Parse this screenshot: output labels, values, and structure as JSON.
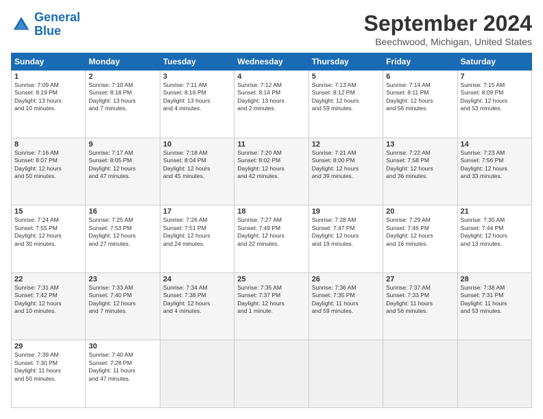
{
  "header": {
    "logo_general": "General",
    "logo_blue": "Blue",
    "month_title": "September 2024",
    "location": "Beechwood, Michigan, United States"
  },
  "days_of_week": [
    "Sunday",
    "Monday",
    "Tuesday",
    "Wednesday",
    "Thursday",
    "Friday",
    "Saturday"
  ],
  "weeks": [
    [
      {
        "day": "1",
        "info": "Sunrise: 7:09 AM\nSunset: 8:19 PM\nDaylight: 13 hours\nand 10 minutes."
      },
      {
        "day": "2",
        "info": "Sunrise: 7:10 AM\nSunset: 8:18 PM\nDaylight: 13 hours\nand 7 minutes."
      },
      {
        "day": "3",
        "info": "Sunrise: 7:11 AM\nSunset: 8:16 PM\nDaylight: 13 hours\nand 4 minutes."
      },
      {
        "day": "4",
        "info": "Sunrise: 7:12 AM\nSunset: 8:14 PM\nDaylight: 13 hours\nand 2 minutes."
      },
      {
        "day": "5",
        "info": "Sunrise: 7:13 AM\nSunset: 8:12 PM\nDaylight: 12 hours\nand 59 minutes."
      },
      {
        "day": "6",
        "info": "Sunrise: 7:14 AM\nSunset: 8:11 PM\nDaylight: 12 hours\nand 56 minutes."
      },
      {
        "day": "7",
        "info": "Sunrise: 7:15 AM\nSunset: 8:09 PM\nDaylight: 12 hours\nand 53 minutes."
      }
    ],
    [
      {
        "day": "8",
        "info": "Sunrise: 7:16 AM\nSunset: 8:07 PM\nDaylight: 12 hours\nand 50 minutes."
      },
      {
        "day": "9",
        "info": "Sunrise: 7:17 AM\nSunset: 8:05 PM\nDaylight: 12 hours\nand 47 minutes."
      },
      {
        "day": "10",
        "info": "Sunrise: 7:18 AM\nSunset: 8:04 PM\nDaylight: 12 hours\nand 45 minutes."
      },
      {
        "day": "11",
        "info": "Sunrise: 7:20 AM\nSunset: 8:02 PM\nDaylight: 12 hours\nand 42 minutes."
      },
      {
        "day": "12",
        "info": "Sunrise: 7:21 AM\nSunset: 8:00 PM\nDaylight: 12 hours\nand 39 minutes."
      },
      {
        "day": "13",
        "info": "Sunrise: 7:22 AM\nSunset: 7:58 PM\nDaylight: 12 hours\nand 36 minutes."
      },
      {
        "day": "14",
        "info": "Sunrise: 7:23 AM\nSunset: 7:56 PM\nDaylight: 12 hours\nand 33 minutes."
      }
    ],
    [
      {
        "day": "15",
        "info": "Sunrise: 7:24 AM\nSunset: 7:55 PM\nDaylight: 12 hours\nand 30 minutes."
      },
      {
        "day": "16",
        "info": "Sunrise: 7:25 AM\nSunset: 7:53 PM\nDaylight: 12 hours\nand 27 minutes."
      },
      {
        "day": "17",
        "info": "Sunrise: 7:26 AM\nSunset: 7:51 PM\nDaylight: 12 hours\nand 24 minutes."
      },
      {
        "day": "18",
        "info": "Sunrise: 7:27 AM\nSunset: 7:49 PM\nDaylight: 12 hours\nand 22 minutes."
      },
      {
        "day": "19",
        "info": "Sunrise: 7:28 AM\nSunset: 7:47 PM\nDaylight: 12 hours\nand 19 minutes."
      },
      {
        "day": "20",
        "info": "Sunrise: 7:29 AM\nSunset: 7:46 PM\nDaylight: 12 hours\nand 16 minutes."
      },
      {
        "day": "21",
        "info": "Sunrise: 7:30 AM\nSunset: 7:44 PM\nDaylight: 12 hours\nand 13 minutes."
      }
    ],
    [
      {
        "day": "22",
        "info": "Sunrise: 7:31 AM\nSunset: 7:42 PM\nDaylight: 12 hours\nand 10 minutes."
      },
      {
        "day": "23",
        "info": "Sunrise: 7:33 AM\nSunset: 7:40 PM\nDaylight: 12 hours\nand 7 minutes."
      },
      {
        "day": "24",
        "info": "Sunrise: 7:34 AM\nSunset: 7:38 PM\nDaylight: 12 hours\nand 4 minutes."
      },
      {
        "day": "25",
        "info": "Sunrise: 7:35 AM\nSunset: 7:37 PM\nDaylight: 12 hours\nand 1 minute."
      },
      {
        "day": "26",
        "info": "Sunrise: 7:36 AM\nSunset: 7:35 PM\nDaylight: 11 hours\nand 59 minutes."
      },
      {
        "day": "27",
        "info": "Sunrise: 7:37 AM\nSunset: 7:33 PM\nDaylight: 11 hours\nand 56 minutes."
      },
      {
        "day": "28",
        "info": "Sunrise: 7:38 AM\nSunset: 7:31 PM\nDaylight: 11 hours\nand 53 minutes."
      }
    ],
    [
      {
        "day": "29",
        "info": "Sunrise: 7:39 AM\nSunset: 7:30 PM\nDaylight: 11 hours\nand 50 minutes."
      },
      {
        "day": "30",
        "info": "Sunrise: 7:40 AM\nSunset: 7:28 PM\nDaylight: 11 hours\nand 47 minutes."
      },
      {
        "day": "",
        "info": ""
      },
      {
        "day": "",
        "info": ""
      },
      {
        "day": "",
        "info": ""
      },
      {
        "day": "",
        "info": ""
      },
      {
        "day": "",
        "info": ""
      }
    ]
  ]
}
